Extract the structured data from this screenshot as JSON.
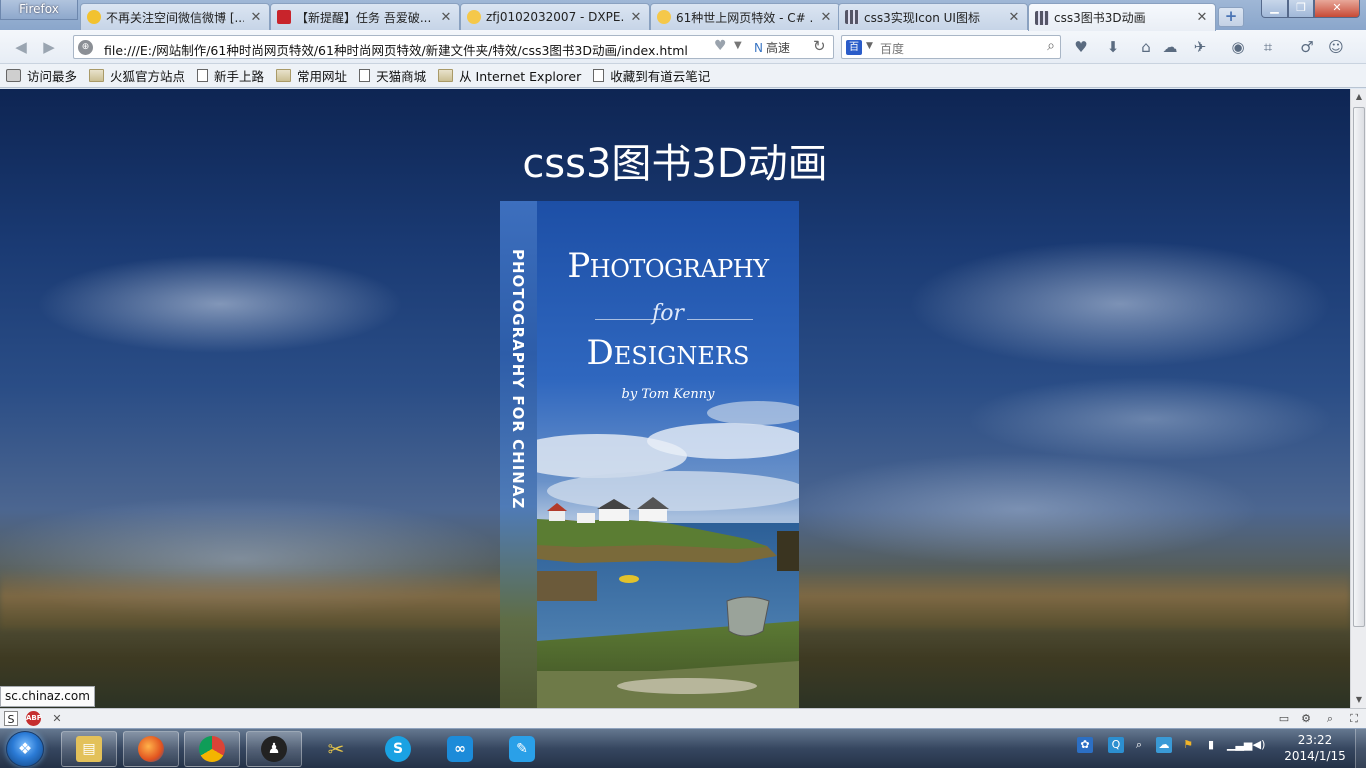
{
  "browser": {
    "menu_button": "Firefox",
    "tabs": [
      {
        "title": "不再关注空间微信微博 [..."
      },
      {
        "title": "【新提醒】任务 吾爱破..."
      },
      {
        "title": "zfj0102032007 - DXPE..."
      },
      {
        "title": "61种世上网页特效 - C# ..."
      },
      {
        "title": "css3实现Icon UI图标"
      },
      {
        "title": "css3图书3D动画"
      }
    ],
    "new_tab": "+",
    "url": "file:///E:/网站制作/61种时尚网页特效/61种时尚网页特效/新建文件夹/特效/css3图书3D动画/index.html",
    "speed_label": "高速",
    "search_placeholder": "百度",
    "bookmarks": [
      {
        "label": "访问最多"
      },
      {
        "label": "火狐官方站点"
      },
      {
        "label": "新手上路"
      },
      {
        "label": "常用网址"
      },
      {
        "label": "天猫商城"
      },
      {
        "label": "从 Internet Explorer"
      },
      {
        "label": "收藏到有道云笔记"
      }
    ],
    "status_link": "sc.chinaz.com"
  },
  "page": {
    "heading": "css3图书3D动画",
    "book": {
      "spine_text": "PHOTOGRAPHY FOR CHINAZ",
      "title_line1": "Photography",
      "title_line2": "for",
      "title_line3": "Designers",
      "author": "by Tom Kenny"
    }
  },
  "taskbar": {
    "time": "23:22",
    "date": "2014/1/15"
  },
  "colors": {
    "sky_dark": "#0e2553",
    "cover_blue": "#2f62b6",
    "taskbar": "#2d3e58"
  }
}
